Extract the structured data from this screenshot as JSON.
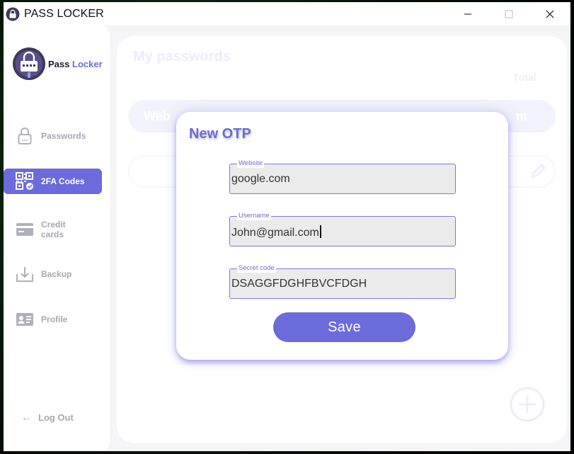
{
  "window": {
    "title": "PASS LOCKER",
    "controls": [
      "minimize-icon",
      "maximize-icon",
      "close-icon"
    ]
  },
  "brand": {
    "name_part1": "Pass",
    "name_part2": "Locker",
    "accent": "#6b6bdc"
  },
  "sidebar": {
    "items": [
      {
        "label": "Passwords",
        "icon": "lock-icon",
        "active": false
      },
      {
        "label": "2FA Codes",
        "icon": "qr-code-icon",
        "active": true
      },
      {
        "label": "Credit cards",
        "label_line1": "Credit",
        "label_line2": "cards",
        "icon": "credit-card-icon",
        "active": false
      },
      {
        "label": "Backup",
        "icon": "download-icon",
        "active": false
      },
      {
        "label": "Profile",
        "icon": "id-card-icon",
        "active": false
      }
    ],
    "logout": {
      "label": "Log Out",
      "icon": "arrow-left-icon"
    }
  },
  "background": {
    "title": "My passwords",
    "tab": "Total",
    "header_left": "Web",
    "header_right": "m"
  },
  "modal": {
    "title": "New OTP",
    "fields": [
      {
        "label": "Website",
        "value": "google.com"
      },
      {
        "label": "Username",
        "value": "John@gmail.com"
      },
      {
        "label": "Secret code",
        "value": "DSAGGFDGHFBVCFDGH"
      }
    ],
    "save_label": "Save"
  }
}
